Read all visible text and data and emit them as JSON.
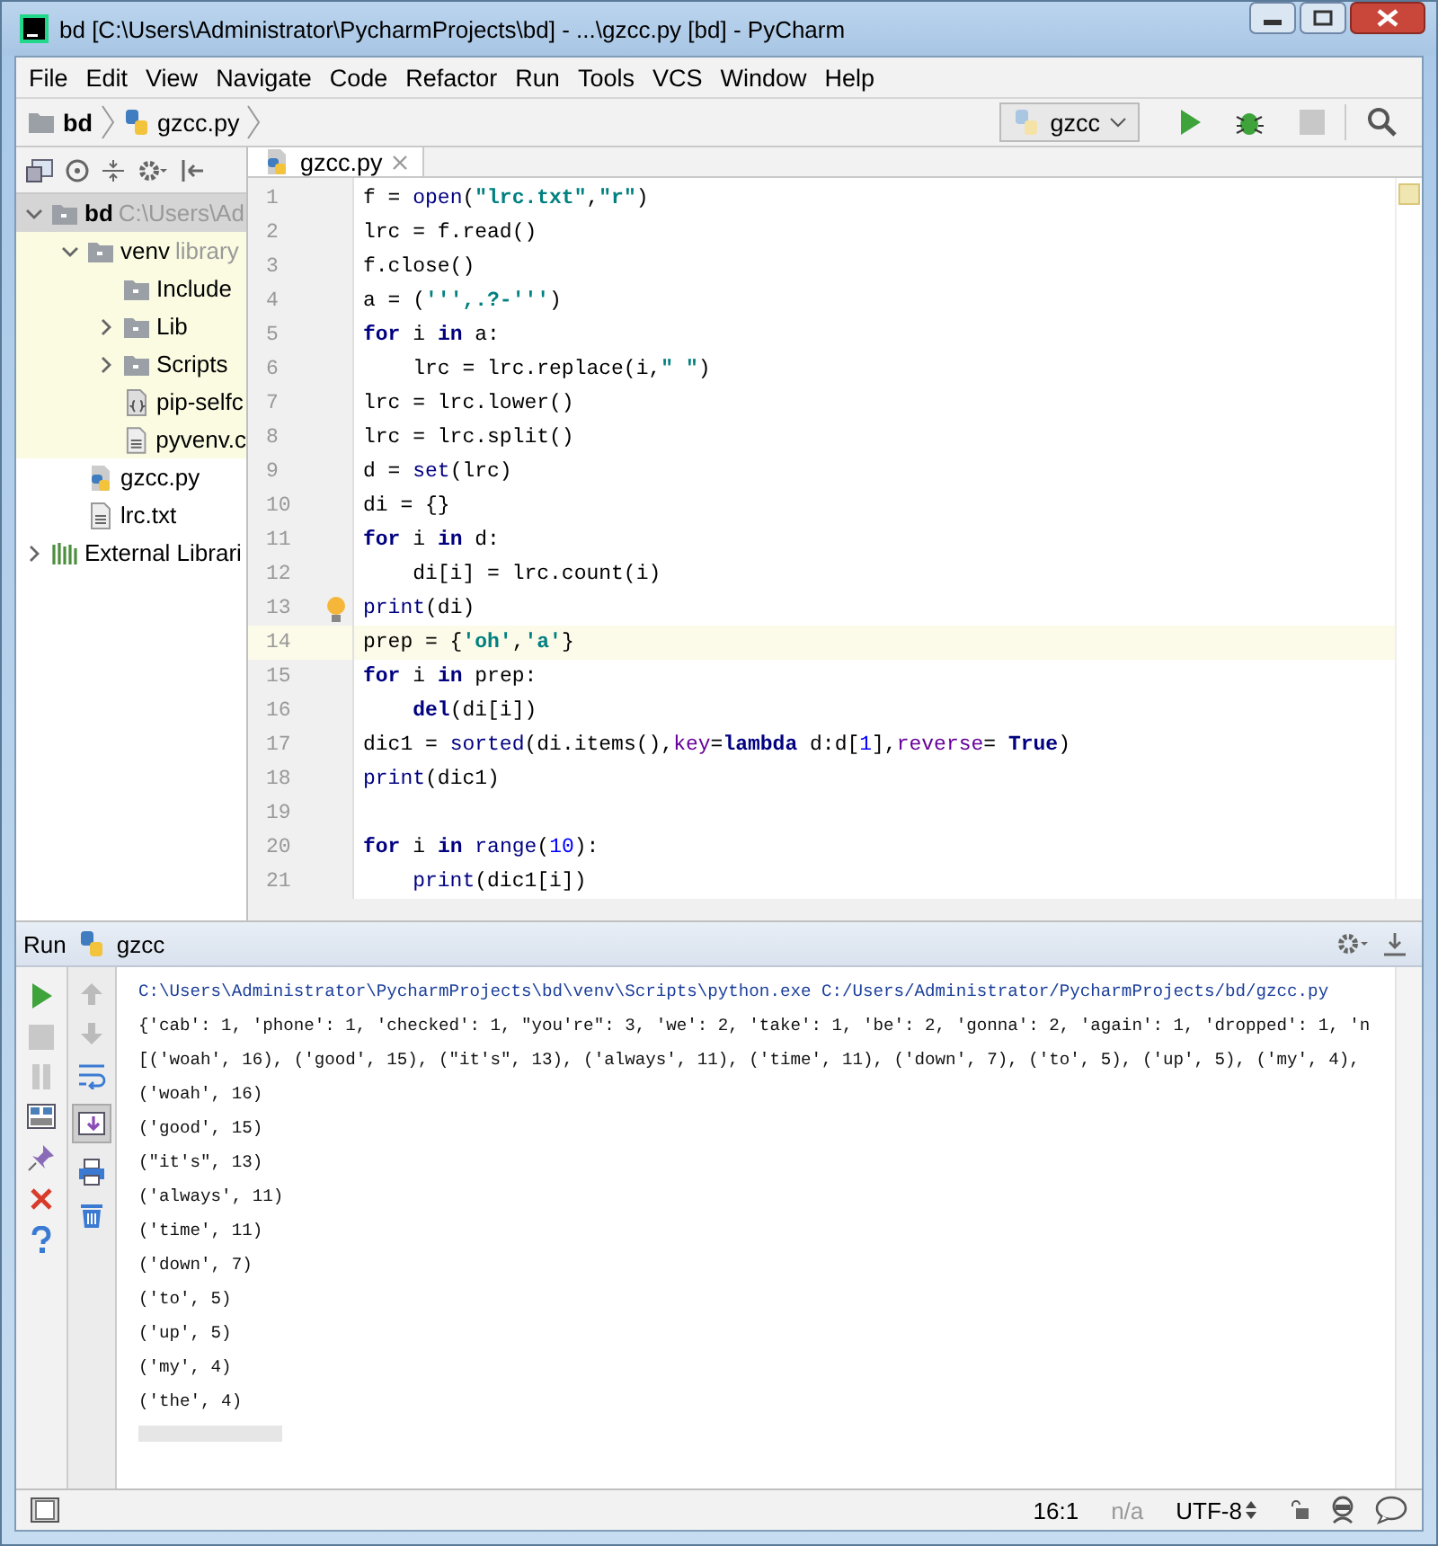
{
  "window": {
    "title": "bd [C:\\Users\\Administrator\\PycharmProjects\\bd] - ...\\gzcc.py [bd] - PyCharm"
  },
  "menu": [
    {
      "label": "File"
    },
    {
      "label": "Edit"
    },
    {
      "label": "View"
    },
    {
      "label": "Navigate"
    },
    {
      "label": "Code"
    },
    {
      "label": "Refactor"
    },
    {
      "label": "Run"
    },
    {
      "label": "Tools"
    },
    {
      "label": "VCS"
    },
    {
      "label": "Window"
    },
    {
      "label": "Help"
    }
  ],
  "breadcrumbs": [
    {
      "label": "bd",
      "kind": "folder"
    },
    {
      "label": "gzcc.py",
      "kind": "python"
    }
  ],
  "run_config": {
    "label": "gzcc"
  },
  "project_tree": [
    {
      "label": "bd",
      "hint": "C:\\Users\\Ad",
      "kind": "folder",
      "selected": true,
      "excluded": false,
      "expanded": true,
      "children": [
        {
          "label": "venv",
          "hint": "library",
          "kind": "folder",
          "selected": false,
          "excluded": true,
          "expanded": true,
          "children": [
            {
              "label": "Include",
              "kind": "folder",
              "selected": false,
              "excluded": true
            },
            {
              "label": "Lib",
              "kind": "folder",
              "selected": false,
              "excluded": true,
              "expanded": false
            },
            {
              "label": "Scripts",
              "kind": "folder",
              "selected": false,
              "excluded": true,
              "expanded": false
            },
            {
              "label": "pip-selfc",
              "kind": "json",
              "selected": false,
              "excluded": true
            },
            {
              "label": "pyvenv.c",
              "kind": "text",
              "selected": false,
              "excluded": true
            }
          ]
        },
        {
          "label": "gzcc.py",
          "kind": "python",
          "selected": false,
          "excluded": false
        },
        {
          "label": "lrc.txt",
          "kind": "text",
          "selected": false,
          "excluded": false
        }
      ]
    },
    {
      "label": "External Librari",
      "kind": "library",
      "selected": false,
      "excluded": false,
      "expanded": false
    }
  ],
  "editor_tabs": [
    {
      "label": "gzcc.py",
      "selected": true
    }
  ],
  "code": [
    {
      "number": "1",
      "current": false,
      "tokens": [
        {
          "kind": "plain",
          "text": "f = "
        },
        {
          "kind": "builtin",
          "text": "open"
        },
        {
          "kind": "plain",
          "text": "("
        },
        {
          "kind": "string",
          "text": "\"lrc.txt\""
        },
        {
          "kind": "plain",
          "text": ","
        },
        {
          "kind": "string",
          "text": "\"r\""
        },
        {
          "kind": "plain",
          "text": ")"
        }
      ]
    },
    {
      "number": "2",
      "current": false,
      "tokens": [
        {
          "kind": "plain",
          "text": "lrc = f.read()"
        }
      ]
    },
    {
      "number": "3",
      "current": false,
      "tokens": [
        {
          "kind": "plain",
          "text": "f.close()"
        }
      ]
    },
    {
      "number": "4",
      "current": false,
      "tokens": [
        {
          "kind": "plain",
          "text": "a = ("
        },
        {
          "kind": "string",
          "text": "''',.?-'''"
        },
        {
          "kind": "plain",
          "text": ")"
        }
      ]
    },
    {
      "number": "5",
      "current": false,
      "tokens": [
        {
          "kind": "keyword",
          "text": "for"
        },
        {
          "kind": "plain",
          "text": " i "
        },
        {
          "kind": "keyword",
          "text": "in"
        },
        {
          "kind": "plain",
          "text": " a:"
        }
      ]
    },
    {
      "number": "6",
      "current": false,
      "tokens": [
        {
          "kind": "plain",
          "text": "    lrc = lrc.replace(i,"
        },
        {
          "kind": "string",
          "text": "\" \""
        },
        {
          "kind": "plain",
          "text": ")"
        }
      ]
    },
    {
      "number": "7",
      "current": false,
      "tokens": [
        {
          "kind": "plain",
          "text": "lrc = lrc.lower()"
        }
      ]
    },
    {
      "number": "8",
      "current": false,
      "tokens": [
        {
          "kind": "plain",
          "text": "lrc = lrc.split()"
        }
      ]
    },
    {
      "number": "9",
      "current": false,
      "tokens": [
        {
          "kind": "plain",
          "text": "d = "
        },
        {
          "kind": "builtin",
          "text": "set"
        },
        {
          "kind": "plain",
          "text": "(lrc)"
        }
      ]
    },
    {
      "number": "10",
      "current": false,
      "tokens": [
        {
          "kind": "plain",
          "text": "di = {}"
        }
      ]
    },
    {
      "number": "11",
      "current": false,
      "tokens": [
        {
          "kind": "keyword",
          "text": "for"
        },
        {
          "kind": "plain",
          "text": " i "
        },
        {
          "kind": "keyword",
          "text": "in"
        },
        {
          "kind": "plain",
          "text": " d:"
        }
      ]
    },
    {
      "number": "12",
      "current": false,
      "tokens": [
        {
          "kind": "plain",
          "text": "    di[i] = lrc.count(i)"
        }
      ]
    },
    {
      "number": "13",
      "current": false,
      "bulb": true,
      "tokens": [
        {
          "kind": "builtin",
          "text": "print"
        },
        {
          "kind": "plain",
          "text": "(di)"
        }
      ]
    },
    {
      "number": "14",
      "current": true,
      "tokens": [
        {
          "kind": "plain",
          "text": "prep = {"
        },
        {
          "kind": "string",
          "text": "'oh'"
        },
        {
          "kind": "plain",
          "text": ","
        },
        {
          "kind": "string",
          "text": "'a'"
        },
        {
          "kind": "plain",
          "text": "}"
        }
      ]
    },
    {
      "number": "15",
      "current": false,
      "tokens": [
        {
          "kind": "keyword",
          "text": "for"
        },
        {
          "kind": "plain",
          "text": " i "
        },
        {
          "kind": "keyword",
          "text": "in"
        },
        {
          "kind": "plain",
          "text": " prep:"
        }
      ]
    },
    {
      "number": "16",
      "current": false,
      "tokens": [
        {
          "kind": "keyword",
          "text": "    del"
        },
        {
          "kind": "plain",
          "text": "(di[i])"
        }
      ]
    },
    {
      "number": "17",
      "current": false,
      "tokens": [
        {
          "kind": "plain",
          "text": "dic1 = "
        },
        {
          "kind": "builtin",
          "text": "sorted"
        },
        {
          "kind": "plain",
          "text": "(di.items(),"
        },
        {
          "kind": "param",
          "text": "key"
        },
        {
          "kind": "plain",
          "text": "="
        },
        {
          "kind": "keyword",
          "text": "lambda"
        },
        {
          "kind": "plain",
          "text": " d:d["
        },
        {
          "kind": "number",
          "text": "1"
        },
        {
          "kind": "plain",
          "text": "],"
        },
        {
          "kind": "param",
          "text": "reverse"
        },
        {
          "kind": "plain",
          "text": "= "
        },
        {
          "kind": "keyword",
          "text": "True"
        },
        {
          "kind": "plain",
          "text": ")"
        }
      ]
    },
    {
      "number": "18",
      "current": false,
      "tokens": [
        {
          "kind": "builtin",
          "text": "print"
        },
        {
          "kind": "plain",
          "text": "(dic1)"
        }
      ]
    },
    {
      "number": "19",
      "current": false
    },
    {
      "number": "20",
      "current": false,
      "tokens": [
        {
          "kind": "keyword",
          "text": "for"
        },
        {
          "kind": "plain",
          "text": " i "
        },
        {
          "kind": "keyword",
          "text": "in"
        },
        {
          "kind": "builtin",
          "text": " range"
        },
        {
          "kind": "plain",
          "text": "("
        },
        {
          "kind": "number",
          "text": "10"
        },
        {
          "kind": "plain",
          "text": "):"
        }
      ]
    },
    {
      "number": "21",
      "current": false,
      "tokens": [
        {
          "kind": "builtin",
          "text": "    print"
        },
        {
          "kind": "plain",
          "text": "(dic1[i])"
        }
      ]
    }
  ],
  "run_panel": {
    "title": "Run",
    "config": "gzcc",
    "output": [
      {
        "kind": "command",
        "text": "C:\\Users\\Administrator\\PycharmProjects\\bd\\venv\\Scripts\\python.exe C:/Users/Administrator/PycharmProjects/bd/gzcc.py"
      },
      {
        "kind": "stdout",
        "text": "{'cab': 1, 'phone': 1, 'checked': 1, \"you're\": 3, 'we': 2, 'take': 1, 'be': 2, 'gonna': 2, 'again': 1, 'dropped': 1, 'n"
      },
      {
        "kind": "stdout",
        "text": "[('woah', 16), ('good', 15), (\"it's\", 13), ('always', 11), ('time', 11), ('down', 7), ('to', 5), ('up', 5), ('my', 4),"
      },
      {
        "kind": "stdout",
        "text": "('woah', 16)"
      },
      {
        "kind": "stdout",
        "text": "('good', 15)"
      },
      {
        "kind": "stdout",
        "text": "(\"it's\", 13)"
      },
      {
        "kind": "stdout",
        "text": "('always', 11)"
      },
      {
        "kind": "stdout",
        "text": "('time', 11)"
      },
      {
        "kind": "stdout",
        "text": "('down', 7)"
      },
      {
        "kind": "stdout",
        "text": "('to', 5)"
      },
      {
        "kind": "stdout",
        "text": "('up', 5)"
      },
      {
        "kind": "stdout",
        "text": "('my', 4)"
      },
      {
        "kind": "stdout",
        "text": "('the', 4)"
      }
    ]
  },
  "status_bar": {
    "position": "16:1",
    "vcs": "n/a",
    "encoding": "UTF-8"
  }
}
